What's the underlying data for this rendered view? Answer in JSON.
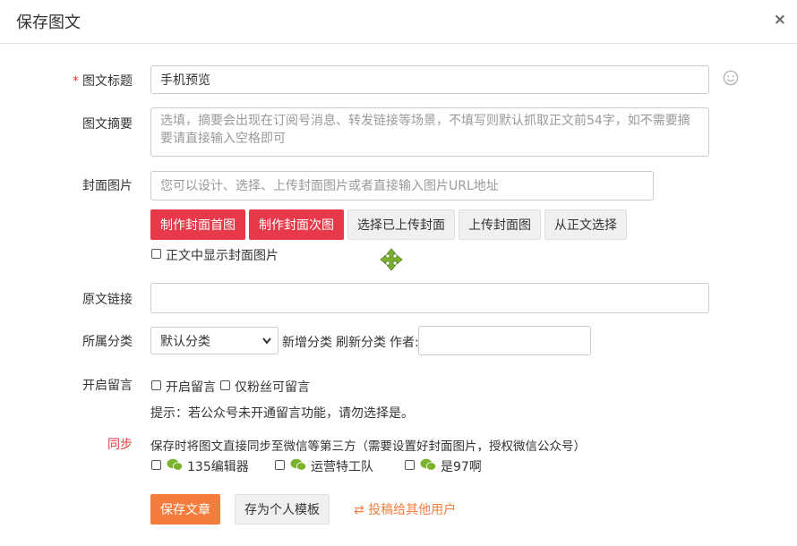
{
  "dialog": {
    "title": "保存图文",
    "close_label": "×"
  },
  "title_field": {
    "label": "图文标题",
    "required_mark": "*",
    "value": "手机预览"
  },
  "summary_field": {
    "label": "图文摘要",
    "placeholder": "选填，摘要会出现在订阅号消息、转发链接等场景，不填写则默认抓取正文前54字，如不需要摘要请直接输入空格即可"
  },
  "cover_field": {
    "label": "封面图片",
    "placeholder": "您可以设计、选择、上传封面图片或者直接输入图片URL地址",
    "buttons": [
      "制作封面首图",
      "制作封面次图",
      "选择已上传封面",
      "上传封面图",
      "从正文选择"
    ],
    "show_in_body_label": "正文中显示封面图片"
  },
  "source_link_field": {
    "label": "原文链接",
    "value": ""
  },
  "category_field": {
    "label": "所属分类",
    "selected": "默认分类",
    "add_label": "新增分类",
    "refresh_label": "刷新分类",
    "author_label": "作者:",
    "author_value": ""
  },
  "comment_field": {
    "label": "开启留言",
    "enable_label": "开启留言",
    "fans_only_label": "仅粉丝可留言",
    "hint": "提示：若公众号未开通留言功能，请勿选择是。"
  },
  "sync_field": {
    "label": "同步",
    "description": "保存时将图文直接同步至微信等第三方（需要设置好封面图片，授权微信公众号）",
    "accounts": [
      "135编辑器",
      "运营特工队",
      "是97啊"
    ]
  },
  "footer": {
    "save_label": "保存文章",
    "template_label": "存为个人模板",
    "submit_label": "投稿给其他用户",
    "submit_icon": "⇄"
  },
  "colors": {
    "primary_red": "#e8394a",
    "orange": "#f47c3c",
    "wechat_green": "#7bb32e"
  }
}
